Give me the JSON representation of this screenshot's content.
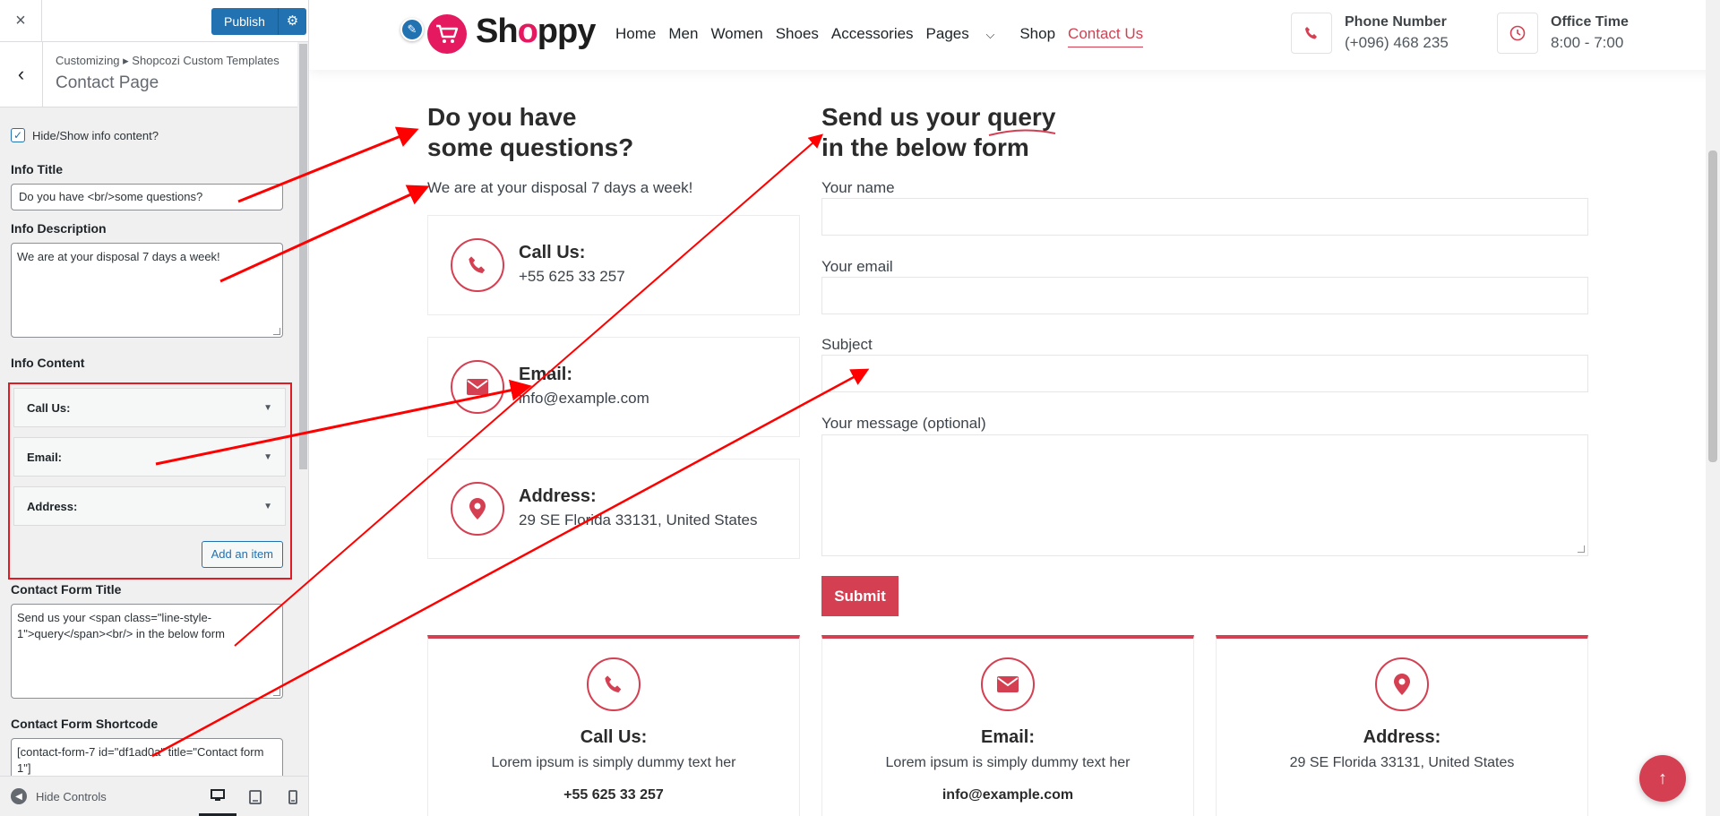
{
  "customizer": {
    "close_icon": "×",
    "publish_label": "Publish",
    "breadcrumb": "Customizing ▸ Shopcozi Custom Templates",
    "title": "Contact Page",
    "hide_show_label": "Hide/Show info content?",
    "hide_show_checked": true,
    "info_title_label": "Info Title",
    "info_title_value": "Do you have <br/>some questions?",
    "info_desc_label": "Info Description",
    "info_desc_value": "We are at your disposal 7 days a week!",
    "info_content_label": "Info Content",
    "info_items": [
      "Call Us:",
      "Email:",
      "Address:"
    ],
    "add_item_label": "Add an item",
    "form_title_label": "Contact Form Title",
    "form_title_value": "Send us your <span class=\"line-style-1\">query</span><br/> in the below form",
    "shortcode_label": "Contact Form Shortcode",
    "shortcode_value": "[contact-form-7 id=\"df1ad0a\" title=\"Contact form 1\"]",
    "hide_controls_label": "Hide Controls"
  },
  "site": {
    "logo": {
      "part1": "Sh",
      "part2": "o",
      "part3": "ppy"
    },
    "nav": [
      "Home",
      "Men",
      "Women",
      "Shoes",
      "Accessories",
      "Pages",
      "Shop",
      "Contact Us"
    ],
    "nav_active": "Contact Us",
    "phone_title": "Phone Number",
    "phone_value": "(+096) 468 235",
    "office_title": "Office Time",
    "office_value": "8:00 - 7:00",
    "info_title_line1": "Do you have",
    "info_title_line2": "some questions?",
    "info_desc": "We are at your disposal 7 days a week!",
    "cards": [
      {
        "title": "Call Us:",
        "text": "+55 625 33 257",
        "icon": "phone-icon"
      },
      {
        "title": "Email:",
        "text": "info@example.com",
        "icon": "envelope-icon"
      },
      {
        "title": "Address:",
        "text": "29 SE Florida 33131, United States",
        "icon": "map-pin-icon"
      }
    ],
    "form_title_pre": "Send us your ",
    "form_title_query": "query",
    "form_title_line2": "in the below form",
    "fields": [
      "Your name",
      "Your email",
      "Subject",
      "Your message (optional)"
    ],
    "submit_label": "Submit",
    "bottom_cards": [
      {
        "title": "Call Us:",
        "text": "Lorem ipsum is simply dummy text her",
        "extra": "+55 625 33 257"
      },
      {
        "title": "Email:",
        "text": "Lorem ipsum is simply dummy text her",
        "extra": "info@example.com"
      },
      {
        "title": "Address:",
        "text": "29 SE Florida 33131, United States",
        "extra": ""
      }
    ]
  },
  "colors": {
    "accent": "#d43f52",
    "brand": "#e5195f",
    "wp_blue": "#2271b1",
    "annotation": "#ff0000"
  }
}
